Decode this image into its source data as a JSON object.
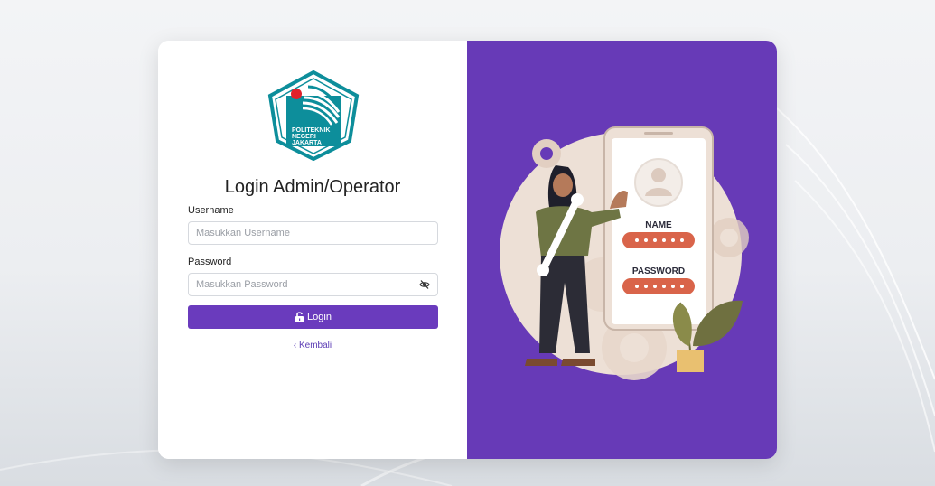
{
  "logo": {
    "icon": "politeknik-negeri-jakarta-logo",
    "text": [
      "POLITEKNIK",
      "NEGERI",
      "JAKARTA"
    ]
  },
  "login": {
    "title": "Login Admin/Operator",
    "username_label": "Username",
    "username_placeholder": "Masukkan Username",
    "username_value": "",
    "password_label": "Password",
    "password_placeholder": "Masukkan Password",
    "password_value": "",
    "password_toggle_icon": "eye-slash-icon",
    "submit_label": "Login",
    "submit_icon": "lock-open-icon",
    "back_label": "Kembali",
    "back_icon": "chevron-left-icon"
  },
  "illustration": {
    "name_label": "NAME",
    "password_label": "PASSWORD"
  },
  "colors": {
    "accent": "#673ab7",
    "button": "#6a3bbd",
    "field_pill": "#d9644a",
    "circle": "#ede0d6"
  }
}
